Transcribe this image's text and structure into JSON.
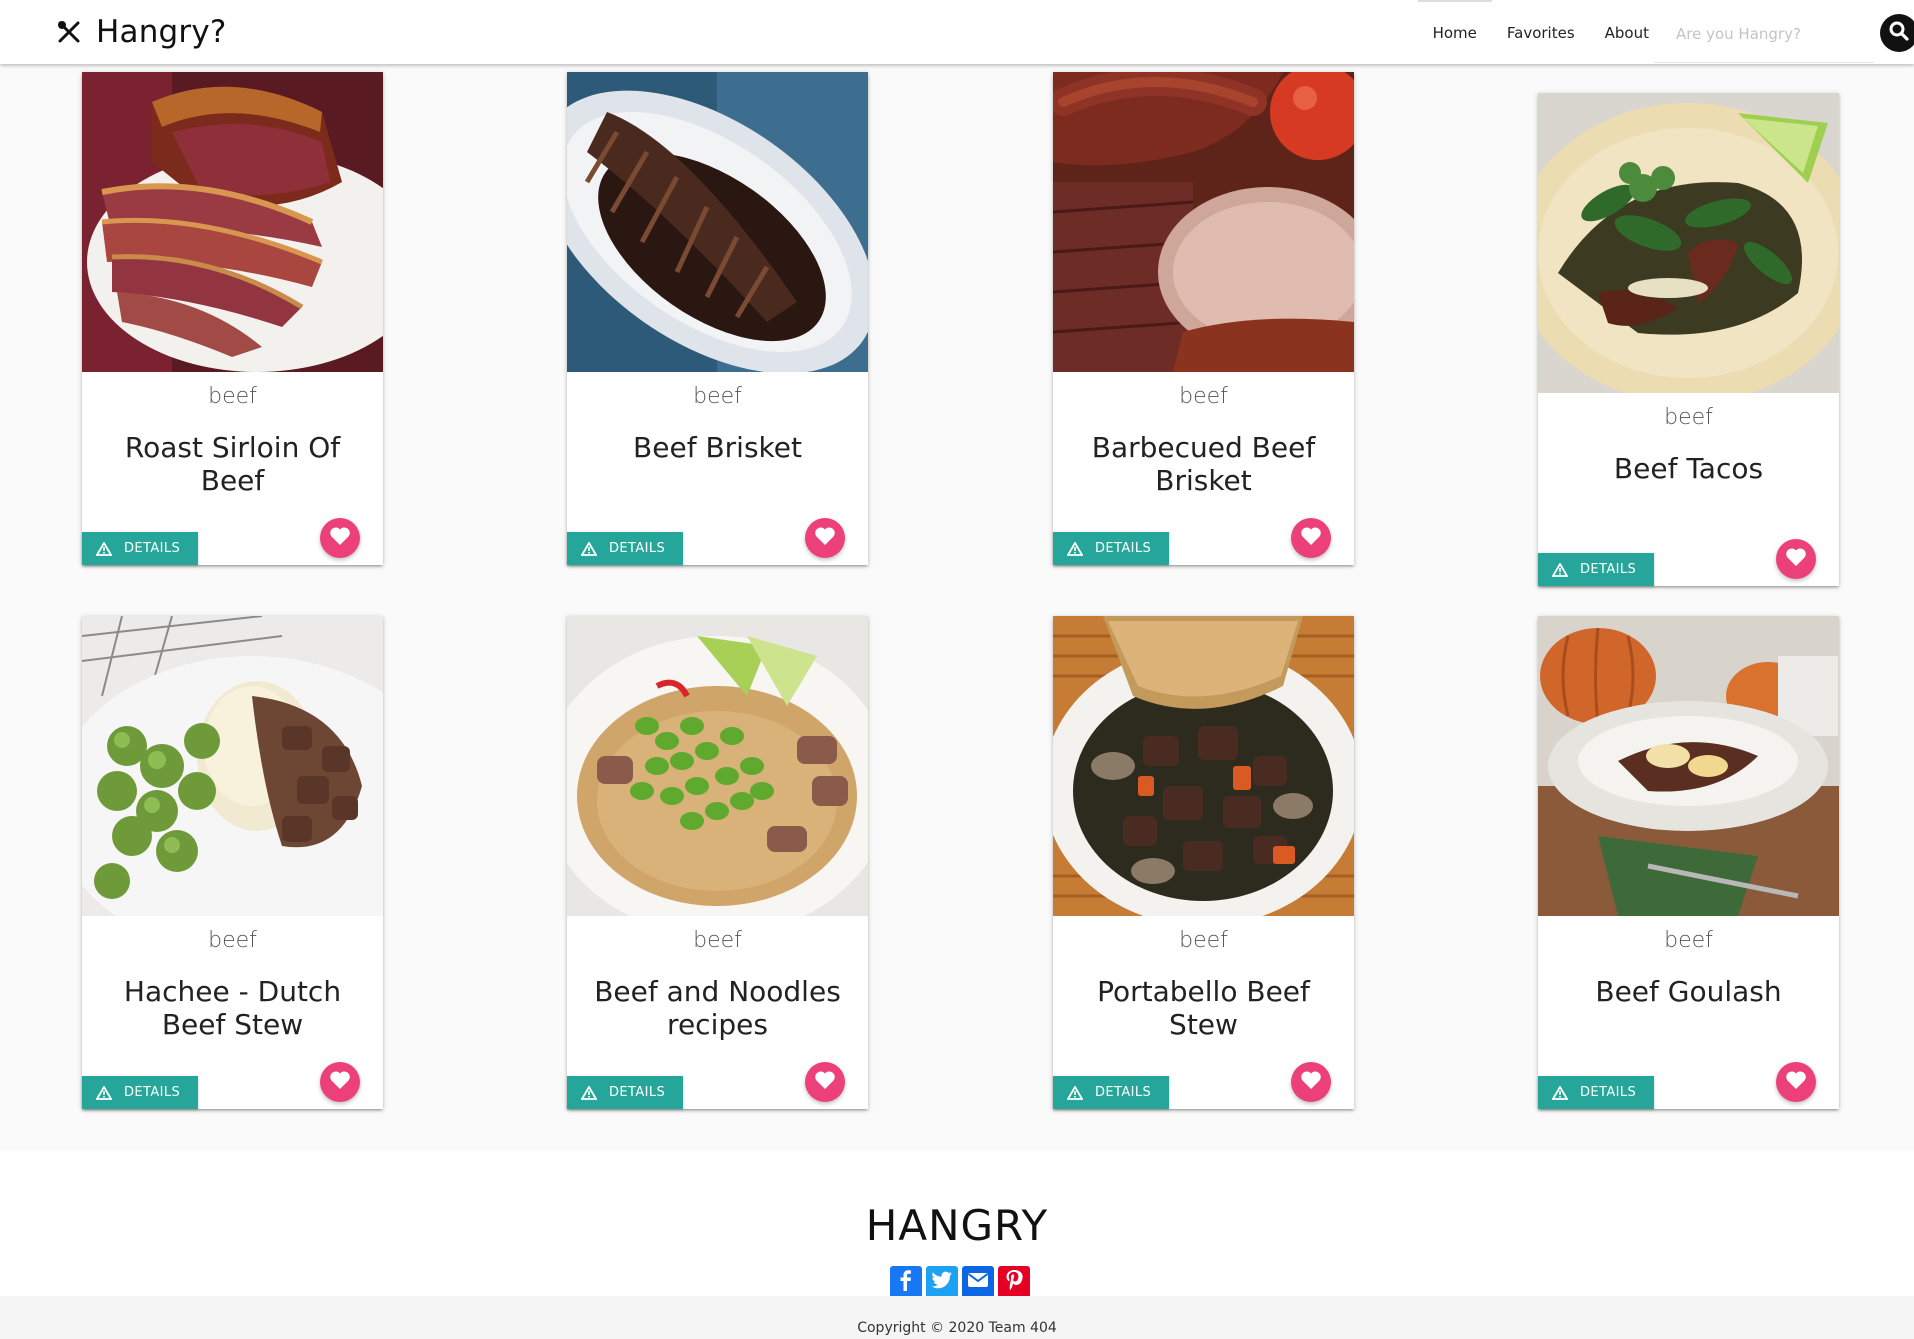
{
  "navbar": {
    "brand_icon": "fork-knife-icon",
    "title": "Hangry?",
    "links": [
      "Home",
      "Favorites",
      "About"
    ],
    "active_link": "Home",
    "search_placeholder": "Are you Hangry?",
    "search_icon": "search-icon"
  },
  "cards": [
    {
      "category": "beef",
      "title": "Roast Sirloin Of Beef",
      "details_label": "DETAILS",
      "image": "roast-sirloin-photo"
    },
    {
      "category": "beef",
      "title": "Beef Brisket",
      "details_label": "DETAILS",
      "image": "beef-brisket-photo"
    },
    {
      "category": "beef",
      "title": "Barbecued Beef Brisket",
      "details_label": "DETAILS",
      "image": "barbecued-brisket-photo"
    },
    {
      "category": "beef",
      "title": "Beef Tacos",
      "details_label": "DETAILS",
      "image": "beef-tacos-photo"
    },
    {
      "category": "beef",
      "title": "Hachee - Dutch Beef Stew",
      "details_label": "DETAILS",
      "image": "hachee-photo"
    },
    {
      "category": "beef",
      "title": "Beef and Noodles recipes",
      "details_label": "DETAILS",
      "image": "beef-noodles-photo"
    },
    {
      "category": "beef",
      "title": "Portabello Beef Stew",
      "details_label": "DETAILS",
      "image": "portabello-stew-photo"
    },
    {
      "category": "beef",
      "title": "Beef Goulash",
      "details_label": "DETAILS",
      "image": "beef-goulash-photo"
    }
  ],
  "colors": {
    "details_button": "#26a69a",
    "favorite_button": "#ec407a",
    "facebook": "#1877f2",
    "twitter": "#1da1f2",
    "email": "#0b66e4",
    "pinterest": "#e60023"
  },
  "footer": {
    "title": "HANGRY",
    "share_icons": [
      "facebook-icon",
      "twitter-icon",
      "email-icon",
      "pinterest-icon"
    ],
    "copyright": "Copyright © 2020 Team 404"
  }
}
